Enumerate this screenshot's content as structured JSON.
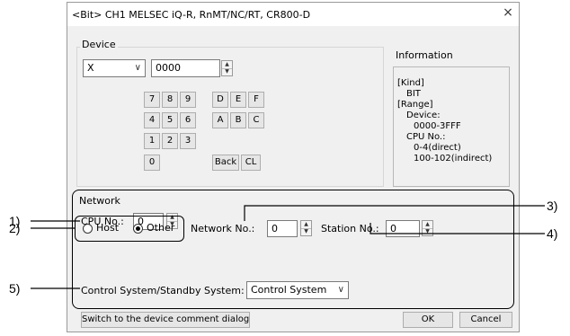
{
  "dialog": {
    "title": "<Bit> CH1 MELSEC iQ-R, RnMT/NC/RT, CR800-D",
    "close_label": "×"
  },
  "device": {
    "group_label": "Device",
    "type_select": "X",
    "number_value": "0000",
    "keypad": {
      "row1": [
        "7",
        "8",
        "9",
        "D",
        "E",
        "F"
      ],
      "row2": [
        "4",
        "5",
        "6",
        "A",
        "B",
        "C"
      ],
      "row3": [
        "1",
        "2",
        "3"
      ],
      "row4": [
        "0"
      ],
      "back_label": "Back",
      "clear_label": "CL"
    }
  },
  "information": {
    "label": "Information",
    "kind_header": "[Kind]",
    "kind_value": "BIT",
    "range_header": "[Range]",
    "device_label": "Device:",
    "device_range": "0000-3FFF",
    "cpu_label": "CPU No.:",
    "cpu_direct": "0-4(direct)",
    "cpu_indirect": "100-102(indirect)"
  },
  "network": {
    "group_label": "Network",
    "cpu_no_label": "CPU No.:",
    "cpu_no_value": "0",
    "host_label": "Host",
    "other_label": "Other",
    "selected_radio": "Other",
    "network_no_label": "Network No.:",
    "network_no_value": "0",
    "station_no_label": "Station No.:",
    "station_no_value": "0",
    "control_label": "Control System/Standby System:",
    "control_value": "Control System"
  },
  "footer": {
    "switch_label": "Switch to the device comment dialog",
    "ok_label": "OK",
    "cancel_label": "Cancel"
  },
  "annotations": {
    "a1": "1)",
    "a2": "2)",
    "a3": "3)",
    "a4": "4)",
    "a5": "5)"
  }
}
